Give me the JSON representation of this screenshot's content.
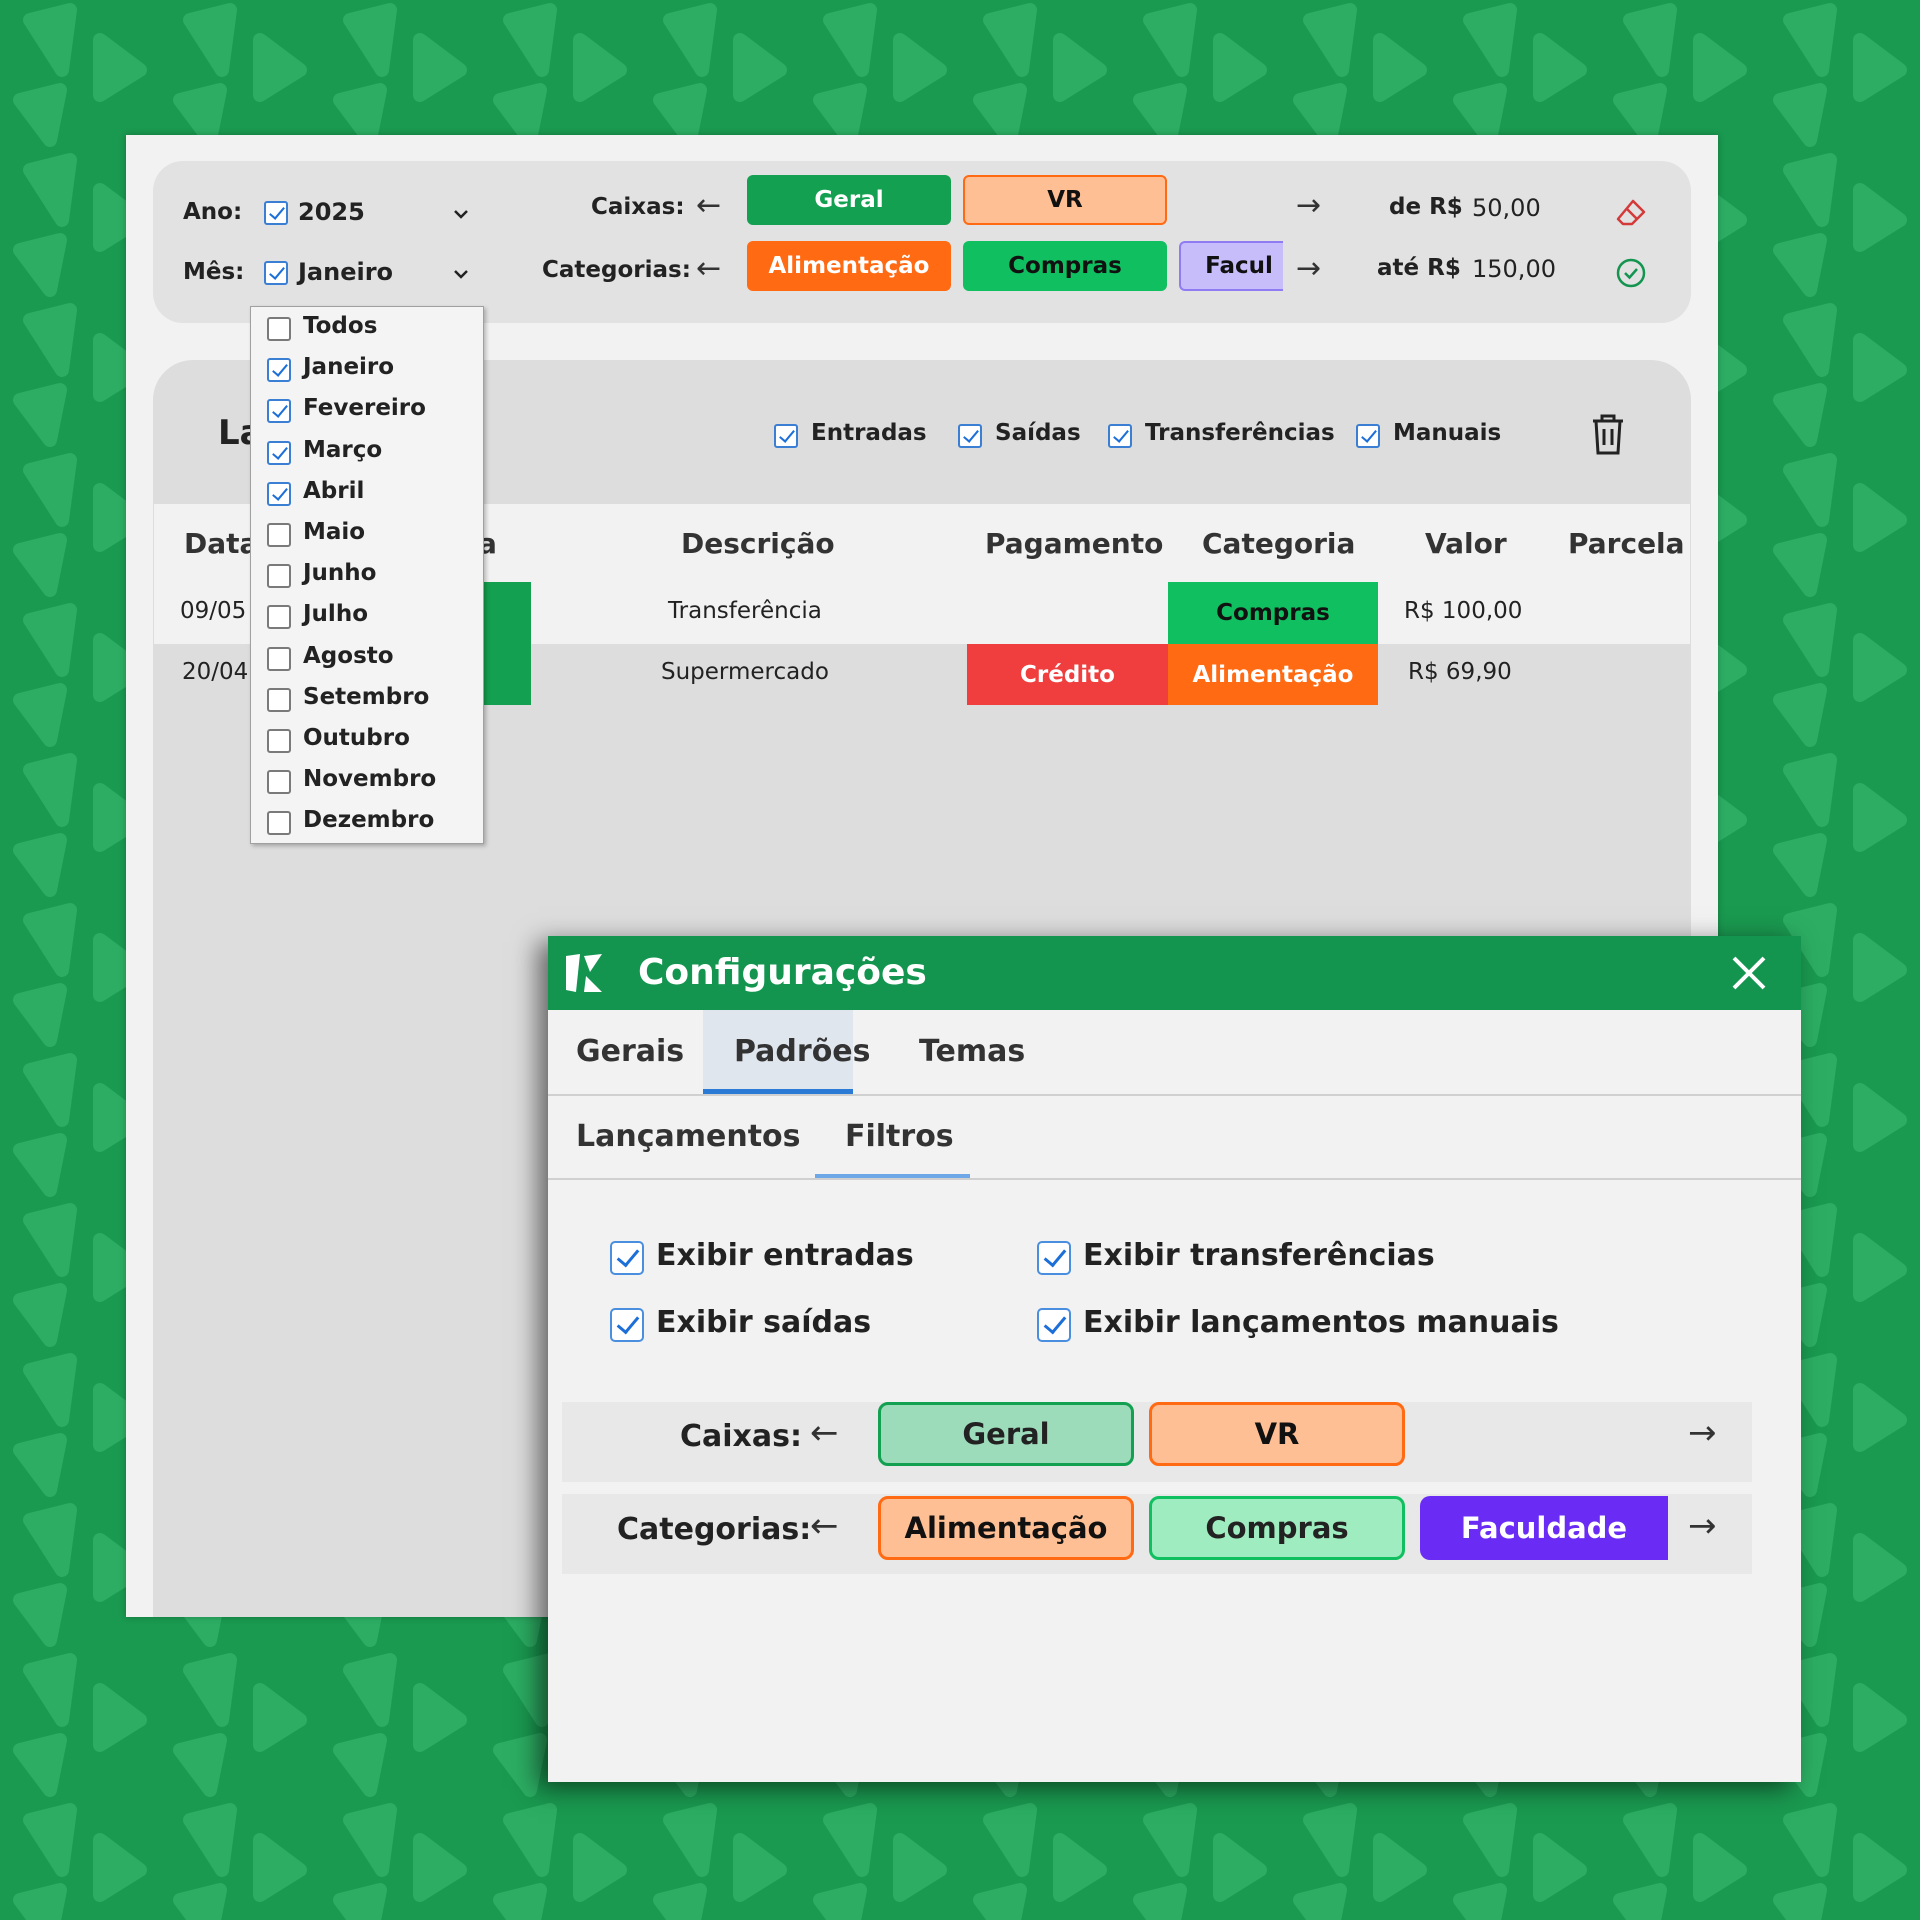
{
  "colors": {
    "bg": "#1a9950",
    "accent": "#139550",
    "orange": "#ff6a13",
    "green": "#10c060",
    "purple": "#8f7cf5",
    "red": "#f03e3e"
  },
  "filters": {
    "ano_label": "Ano:",
    "ano_value": "2025",
    "mes_label": "Mês:",
    "mes_value": "Janeiro",
    "caixas_label": "Caixas:",
    "categorias_label": "Categorias:",
    "caixas": [
      "Geral",
      "VR"
    ],
    "categorias": [
      "Alimentação",
      "Compras",
      "Facul"
    ],
    "de_label": "de R$",
    "de_value": "50,00",
    "ate_label": "até R$",
    "ate_value": "150,00"
  },
  "month_dropdown": [
    {
      "label": "Todos",
      "checked": false
    },
    {
      "label": "Janeiro",
      "checked": true
    },
    {
      "label": "Fevereiro",
      "checked": true
    },
    {
      "label": "Março",
      "checked": true
    },
    {
      "label": "Abril",
      "checked": true
    },
    {
      "label": "Maio",
      "checked": false
    },
    {
      "label": "Junho",
      "checked": false
    },
    {
      "label": "Julho",
      "checked": false
    },
    {
      "label": "Agosto",
      "checked": false
    },
    {
      "label": "Setembro",
      "checked": false
    },
    {
      "label": "Outubro",
      "checked": false
    },
    {
      "label": "Novembro",
      "checked": false
    },
    {
      "label": "Dezembro",
      "checked": false
    }
  ],
  "panel": {
    "title_partial": "La",
    "toggles": [
      "Entradas",
      "Saídas",
      "Transferências",
      "Manuais"
    ]
  },
  "table": {
    "headers": [
      "Data",
      "Descrição",
      "Pagamento",
      "Categoria",
      "Valor",
      "Parcela"
    ],
    "header_partial": "a",
    "rows": [
      {
        "data": "09/05",
        "descricao": "Transferência",
        "pagamento": "",
        "categoria": "Compras",
        "valor": "R$ 100,00",
        "parcela": ""
      },
      {
        "data": "20/04",
        "descricao": "Supermercado",
        "pagamento": "Crédito",
        "categoria": "Alimentação",
        "valor": "R$ 69,90",
        "parcela": ""
      }
    ]
  },
  "config": {
    "title": "Configurações",
    "tabs": [
      "Gerais",
      "Padrões",
      "Temas"
    ],
    "active_tab": "Padrões",
    "subtabs": [
      "Lançamentos",
      "Filtros"
    ],
    "active_subtab": "Filtros",
    "options": [
      {
        "label": "Exibir entradas",
        "checked": true
      },
      {
        "label": "Exibir transferências",
        "checked": true
      },
      {
        "label": "Exibir saídas",
        "checked": true
      },
      {
        "label": "Exibir lançamentos manuais",
        "checked": true
      }
    ],
    "caixas_label": "Caixas:",
    "categorias_label": "Categorias:",
    "caixas": [
      "Geral",
      "VR"
    ],
    "categorias": [
      "Alimentação",
      "Compras",
      "Faculdade"
    ]
  }
}
